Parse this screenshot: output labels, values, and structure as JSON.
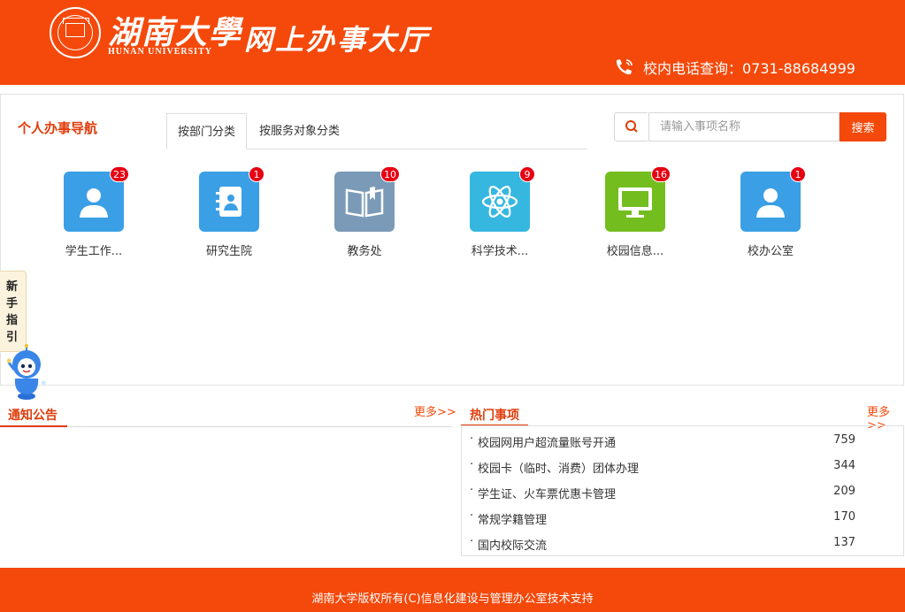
{
  "header": {
    "brand_cn": "湖南大學",
    "brand_en": "HUNAN UNIVERSITY",
    "hall_title": "网上办事大厅",
    "phone_text": "校内电话查询：0731-88684999"
  },
  "nav": {
    "title": "个人办事导航",
    "tabs": [
      {
        "label": "按部门分类",
        "active": true
      },
      {
        "label": "按服务对象分类",
        "active": false
      }
    ]
  },
  "search": {
    "placeholder": "请输入事项名称",
    "button": "搜索"
  },
  "departments": [
    {
      "label": "学生工作...",
      "count": "23",
      "icon": "person-icon",
      "color": "#3b9fe5"
    },
    {
      "label": "研究生院",
      "count": "1",
      "icon": "contact-book-icon",
      "color": "#3b9fe5"
    },
    {
      "label": "教务处",
      "count": "10",
      "icon": "open-book-icon",
      "color": "#7a9ab8"
    },
    {
      "label": "科学技术...",
      "count": "9",
      "icon": "atom-icon",
      "color": "#36b7e0"
    },
    {
      "label": "校园信息...",
      "count": "16",
      "icon": "monitor-icon",
      "color": "#74bd1f"
    },
    {
      "label": "校办公室",
      "count": "1",
      "icon": "person-icon",
      "color": "#3b9fe5"
    }
  ],
  "guide": {
    "label": "新手指引"
  },
  "notices": {
    "title": "通知公告",
    "more": "更多>>"
  },
  "hot": {
    "title": "热门事项",
    "more": "更多>>",
    "bullet": "·",
    "items": [
      {
        "name": "校园网用户超流量账号开通",
        "count": "759"
      },
      {
        "name": "校园卡（临时、消费）团体办理",
        "count": "344"
      },
      {
        "name": "学生证、火车票优惠卡管理",
        "count": "209"
      },
      {
        "name": "常规学籍管理",
        "count": "170"
      },
      {
        "name": "国内校际交流",
        "count": "137"
      }
    ]
  },
  "footer": {
    "text": "湖南大学版权所有(C)信息化建设与管理办公室技术支持"
  },
  "colors": {
    "brand": "#f4490b",
    "accent": "#e03c0a",
    "badge": "#e60012"
  }
}
